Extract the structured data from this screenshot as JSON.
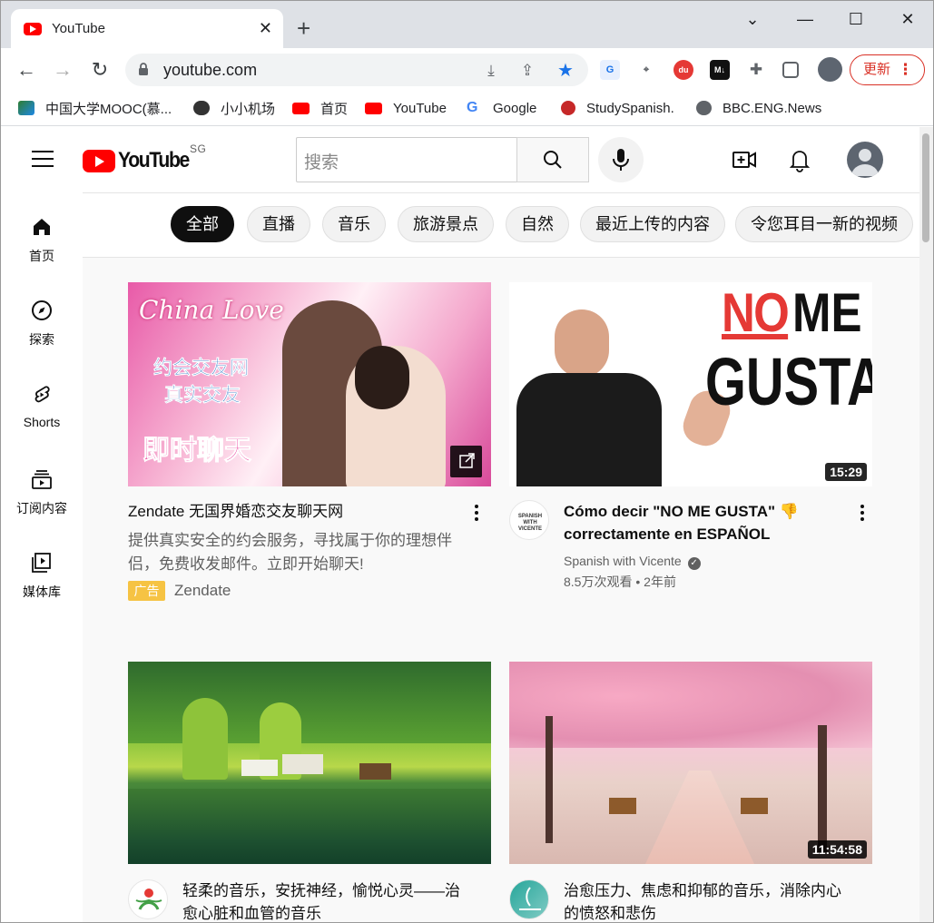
{
  "browser": {
    "tab_title": "YouTube",
    "url": "youtube.com",
    "update_label": "更新",
    "bookmarks": [
      "中国大学MOOC(慕...",
      "小小机场",
      "首页",
      "YouTube",
      "Google",
      "StudySpanish.",
      "BBC.ENG.News"
    ]
  },
  "youtube": {
    "country_code": "SG",
    "search_placeholder": "搜索",
    "chips": [
      "全部",
      "直播",
      "音乐",
      "旅游景点",
      "自然",
      "最近上传的内容",
      "令您耳目一新的视频"
    ],
    "sidebar": [
      {
        "label": "首页",
        "icon": "home-icon"
      },
      {
        "label": "探索",
        "icon": "compass-icon"
      },
      {
        "label": "Shorts",
        "icon": "shorts-icon"
      },
      {
        "label": "订阅内容",
        "icon": "subscriptions-icon"
      },
      {
        "label": "媒体库",
        "icon": "library-icon"
      }
    ],
    "videos": [
      {
        "title": "Zendate 无国界婚恋交友聊天网",
        "description": "提供真实安全的约会服务，寻找属于你的理想伴侣，免费收发邮件。立即开始聊天!",
        "ad_badge": "广告",
        "channel": "Zendate",
        "thumb_title": "China Love",
        "thumb_line1": "约会交友网",
        "thumb_line2": "真实交友",
        "thumb_line3": "即时聊天"
      },
      {
        "title": "Cómo decir \"NO ME GUSTA\" 👎 correctamente en ESPAÑOL",
        "channel": "Spanish with Vicente",
        "views": "8.5万次观看",
        "age": "2年前",
        "duration": "15:29",
        "thumb_no": "NO",
        "thumb_me": "ME",
        "thumb_gusta": "GUSTA"
      },
      {
        "title": "轻柔的音乐，安抚神经，愉悦心灵——治愈心脏和血管的音乐",
        "channel": ""
      },
      {
        "title": "治愈压力、焦虑和抑郁的音乐，消除内心的愤怒和悲伤",
        "duration": "11:54:58",
        "channel": ""
      }
    ]
  },
  "colors": {
    "brand_red": "#ff0000",
    "ad_yellow": "#f6c343",
    "update_red": "#d93025",
    "star_blue": "#1a73e8"
  }
}
